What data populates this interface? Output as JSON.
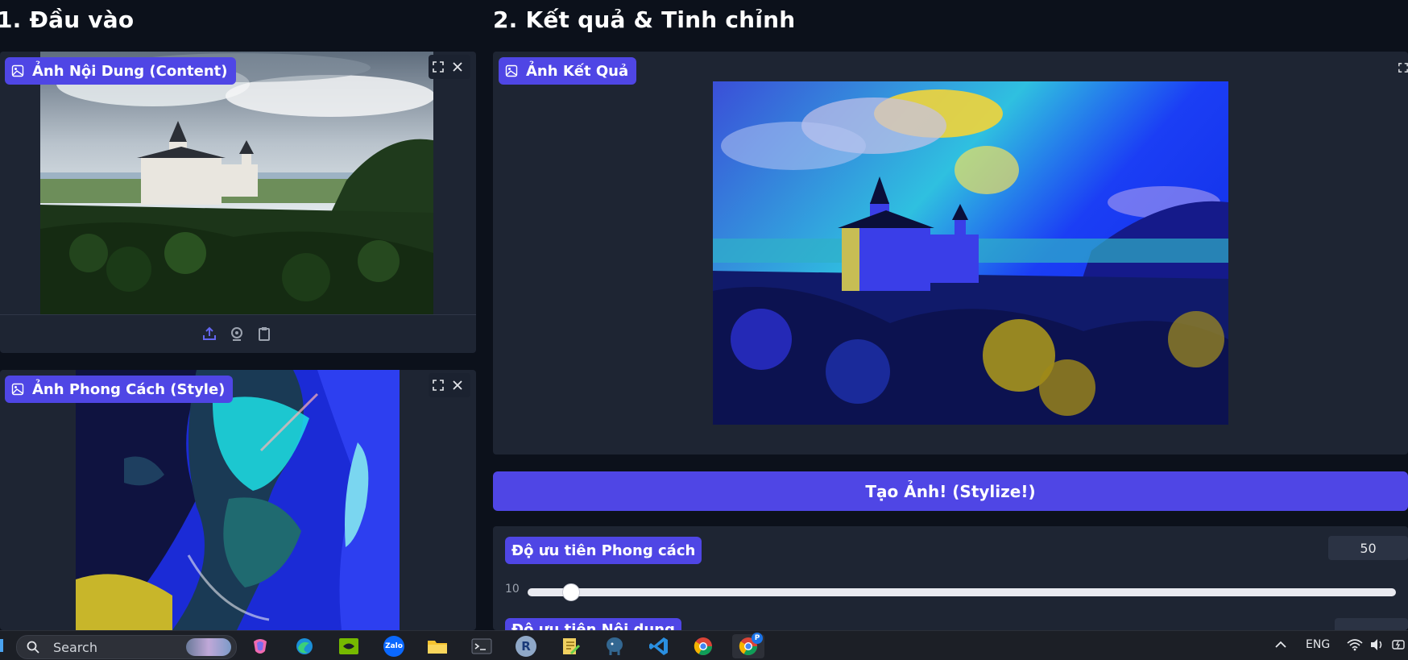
{
  "headings": {
    "input": "1. Đầu vào",
    "result": "2. Kết quả & Tinh chỉnh"
  },
  "content_image": {
    "label": "Ảnh Nội Dung (Content)",
    "icon": "image-icon",
    "toolbar_icons": [
      "upload-icon",
      "webcam-icon",
      "clipboard-icon"
    ]
  },
  "style_image": {
    "label": "Ảnh Phong Cách (Style)",
    "icon": "image-icon"
  },
  "result_image": {
    "label": "Ảnh Kết Quả",
    "icon": "image-icon"
  },
  "stylize_button": "Tạo Ảnh! (Stylize!)",
  "style_weight": {
    "label": "Độ ưu tiên Phong cách",
    "value": "50",
    "min_label": "10",
    "slider_fraction": 0.05
  },
  "content_weight": {
    "label": "Độ ưu tiên Nội dung"
  },
  "taskbar": {
    "search_placeholder": "Search",
    "language": "ENG",
    "apps": [
      "copilot-icon",
      "edge-icon",
      "nvidia-icon",
      "zalo-icon",
      "file-explorer-icon",
      "terminal-icon",
      "r-icon",
      "notepad-icon",
      "postgres-icon",
      "vscode-icon",
      "chrome-icon",
      "chrome-profile-icon"
    ],
    "zalo_label": "Zalo",
    "r_label": "R",
    "profile_badge": "P"
  },
  "colors": {
    "background": "#0c111b",
    "panel": "#1e2533",
    "accent": "#4f46e5"
  }
}
